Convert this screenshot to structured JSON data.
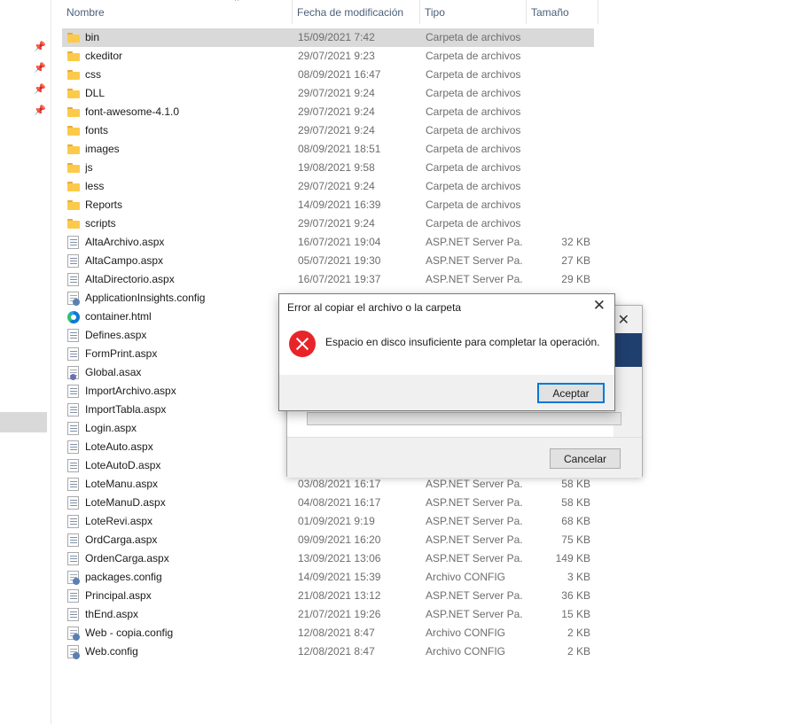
{
  "header": {
    "columns": [
      "Nombre",
      "Fecha de modificación",
      "Tipo",
      "Tamaño"
    ]
  },
  "nav": {
    "pin_icon": "pin-icon",
    "pin_count": 4
  },
  "files": [
    {
      "name": "bin",
      "date": "15/09/2021 7:42",
      "type": "Carpeta de archivos",
      "size": "",
      "icon": "folder",
      "selected": true
    },
    {
      "name": "ckeditor",
      "date": "29/07/2021 9:23",
      "type": "Carpeta de archivos",
      "size": "",
      "icon": "folder"
    },
    {
      "name": "css",
      "date": "08/09/2021 16:47",
      "type": "Carpeta de archivos",
      "size": "",
      "icon": "folder"
    },
    {
      "name": "DLL",
      "date": "29/07/2021 9:24",
      "type": "Carpeta de archivos",
      "size": "",
      "icon": "folder"
    },
    {
      "name": "font-awesome-4.1.0",
      "date": "29/07/2021 9:24",
      "type": "Carpeta de archivos",
      "size": "",
      "icon": "folder"
    },
    {
      "name": "fonts",
      "date": "29/07/2021 9:24",
      "type": "Carpeta de archivos",
      "size": "",
      "icon": "folder"
    },
    {
      "name": "images",
      "date": "08/09/2021 18:51",
      "type": "Carpeta de archivos",
      "size": "",
      "icon": "folder"
    },
    {
      "name": "js",
      "date": "19/08/2021 9:58",
      "type": "Carpeta de archivos",
      "size": "",
      "icon": "folder"
    },
    {
      "name": "less",
      "date": "29/07/2021 9:24",
      "type": "Carpeta de archivos",
      "size": "",
      "icon": "folder"
    },
    {
      "name": "Reports",
      "date": "14/09/2021 16:39",
      "type": "Carpeta de archivos",
      "size": "",
      "icon": "folder"
    },
    {
      "name": "scripts",
      "date": "29/07/2021 9:24",
      "type": "Carpeta de archivos",
      "size": "",
      "icon": "folder"
    },
    {
      "name": "AltaArchivo.aspx",
      "date": "16/07/2021 19:04",
      "type": "ASP.NET Server Pa...",
      "size": "32 KB",
      "icon": "aspx"
    },
    {
      "name": "AltaCampo.aspx",
      "date": "05/07/2021 19:30",
      "type": "ASP.NET Server Pa...",
      "size": "27 KB",
      "icon": "aspx"
    },
    {
      "name": "AltaDirectorio.aspx",
      "date": "16/07/2021 19:37",
      "type": "ASP.NET Server Pa...",
      "size": "29 KB",
      "icon": "aspx"
    },
    {
      "name": "ApplicationInsights.config",
      "date": "",
      "type": "",
      "size": "",
      "icon": "config"
    },
    {
      "name": "container.html",
      "date": "",
      "type": "",
      "size": "",
      "icon": "edge"
    },
    {
      "name": "Defines.aspx",
      "date": "",
      "type": "",
      "size": "",
      "icon": "aspx"
    },
    {
      "name": "FormPrint.aspx",
      "date": "",
      "type": "",
      "size": "",
      "icon": "aspx"
    },
    {
      "name": "Global.asax",
      "date": "",
      "type": "",
      "size": "",
      "icon": "asax"
    },
    {
      "name": "ImportArchivo.aspx",
      "date": "",
      "type": "",
      "size": "",
      "icon": "aspx"
    },
    {
      "name": "ImportTabla.aspx",
      "date": "",
      "type": "",
      "size": "",
      "icon": "aspx"
    },
    {
      "name": "Login.aspx",
      "date": "",
      "type": "",
      "size": "",
      "icon": "aspx"
    },
    {
      "name": "LoteAuto.aspx",
      "date": "",
      "type": "",
      "size": "",
      "icon": "aspx"
    },
    {
      "name": "LoteAutoD.aspx",
      "date": "",
      "type": "",
      "size": "",
      "icon": "aspx"
    },
    {
      "name": "LoteManu.aspx",
      "date": "03/08/2021 16:17",
      "type": "ASP.NET Server Pa...",
      "size": "58 KB",
      "icon": "aspx"
    },
    {
      "name": "LoteManuD.aspx",
      "date": "04/08/2021 16:17",
      "type": "ASP.NET Server Pa...",
      "size": "58 KB",
      "icon": "aspx"
    },
    {
      "name": "LoteRevi.aspx",
      "date": "01/09/2021 9:19",
      "type": "ASP.NET Server Pa...",
      "size": "68 KB",
      "icon": "aspx"
    },
    {
      "name": "OrdCarga.aspx",
      "date": "09/09/2021 16:20",
      "type": "ASP.NET Server Pa...",
      "size": "75 KB",
      "icon": "aspx"
    },
    {
      "name": "OrdenCarga.aspx",
      "date": "13/09/2021 13:06",
      "type": "ASP.NET Server Pa...",
      "size": "149 KB",
      "icon": "aspx"
    },
    {
      "name": "packages.config",
      "date": "14/09/2021 15:39",
      "type": "Archivo CONFIG",
      "size": "3 KB",
      "icon": "config"
    },
    {
      "name": "Principal.aspx",
      "date": "21/08/2021 13:12",
      "type": "ASP.NET Server Pa...",
      "size": "36 KB",
      "icon": "aspx"
    },
    {
      "name": "thEnd.aspx",
      "date": "21/07/2021 19:26",
      "type": "ASP.NET Server Pa...",
      "size": "15 KB",
      "icon": "aspx"
    },
    {
      "name": "Web - copia.config",
      "date": "12/08/2021 8:47",
      "type": "Archivo CONFIG",
      "size": "2 KB",
      "icon": "config"
    },
    {
      "name": "Web.config",
      "date": "12/08/2021 8:47",
      "type": "Archivo CONFIG",
      "size": "2 KB",
      "icon": "config"
    }
  ],
  "progress_dialog": {
    "cancel_label": "Cancelar"
  },
  "error_dialog": {
    "title": "Error al copiar el archivo o la carpeta",
    "message": "Espacio en disco insuficiente para completar la operación.",
    "accept_label": "Aceptar",
    "close_glyph": "✕",
    "icon": "error-icon",
    "icon_color": "#e8242a"
  },
  "colors": {
    "selection": "#d9d9d9",
    "accent": "#0078d7",
    "header_text": "#4c607a"
  }
}
